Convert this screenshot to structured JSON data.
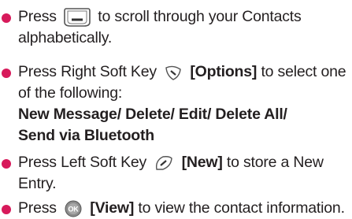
{
  "bullet_color": "#d71a5b",
  "items": [
    {
      "press": "Press",
      "rest": "to scroll through your Contacts",
      "line2": "alphabetically.",
      "icon": "navigation-key-icon"
    },
    {
      "lead": "Press Right Soft Key",
      "key": "[Options]",
      "rest": "to select one",
      "line2": "of the following:",
      "opt_new_message": "New Message",
      "opt_delete": "Delete",
      "opt_edit": "Edit",
      "opt_delete_all": "Delete All",
      "opt_send": "Send via Bluetooth",
      "icon": "right-soft-key-icon"
    },
    {
      "lead": "Press Left Soft Key",
      "key": "[New]",
      "rest": "to store a New",
      "line2": "Entry.",
      "icon": "left-soft-key-icon"
    },
    {
      "press": "Press",
      "key": "[View]",
      "rest": "to view the contact information.",
      "icon": "ok-key-icon"
    }
  ]
}
